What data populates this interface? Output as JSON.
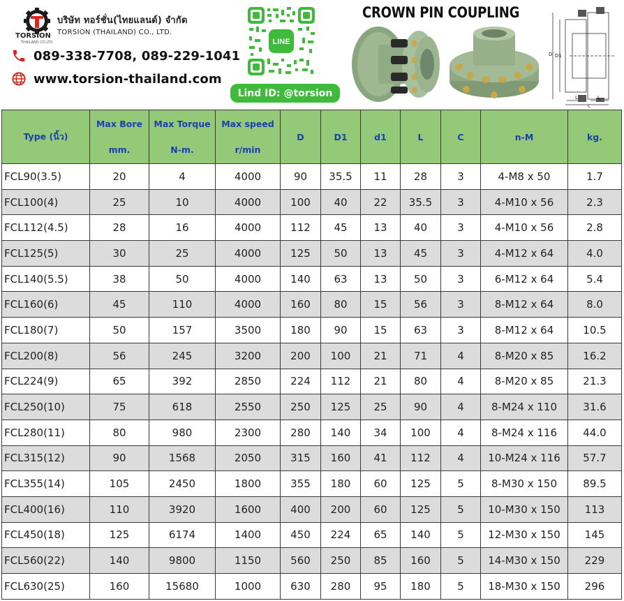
{
  "company": {
    "name_th": "บริษัท ทอร์ชั่น(ไทยแลนด์) จำกัด",
    "name_en": "TORSION (THAILAND) CO., LTD.",
    "logo_text": "TORSION",
    "logo_subtext": "THAILAND CO LTD",
    "phone": "089-338-7708,  089-229-1041",
    "website": "www.torsion-thailand.com",
    "line_id": "Lind ID: @torsion",
    "qr_label": "LINE"
  },
  "product_title": "CROWN PIN COUPLING",
  "drawing_labels": {
    "D": "D",
    "D1": "D1",
    "L": "L",
    "C": "C"
  },
  "colors": {
    "header_bg": "#94c978",
    "header_text": "#1a3fb2",
    "alt_row": "#dcdcdc",
    "line_green": "#3fba3b",
    "brand_red": "#d9261c"
  },
  "table": {
    "headers": [
      {
        "top": "Type (นิ้ว)",
        "bottom": ""
      },
      {
        "top": "Max Bore",
        "bottom": "mm."
      },
      {
        "top": "Max Torque",
        "bottom": "N-m."
      },
      {
        "top": "Max speed",
        "bottom": "r/min"
      },
      {
        "top": "D",
        "bottom": ""
      },
      {
        "top": "D1",
        "bottom": ""
      },
      {
        "top": "d1",
        "bottom": ""
      },
      {
        "top": "L",
        "bottom": ""
      },
      {
        "top": "C",
        "bottom": ""
      },
      {
        "top": "n-M",
        "bottom": ""
      },
      {
        "top": "kg.",
        "bottom": ""
      }
    ],
    "rows": [
      [
        "FCL90(3.5)",
        "20",
        "4",
        "4000",
        "90",
        "35.5",
        "11",
        "28",
        "3",
        "4-M8 x 50",
        "1.7"
      ],
      [
        "FCL100(4)",
        "25",
        "10",
        "4000",
        "100",
        "40",
        "22",
        "35.5",
        "3",
        "4-M10 x 56",
        "2.3"
      ],
      [
        "FCL112(4.5)",
        "28",
        "16",
        "4000",
        "112",
        "45",
        "13",
        "40",
        "3",
        "4-M10 x 56",
        "2.8"
      ],
      [
        "FCL125(5)",
        "30",
        "25",
        "4000",
        "125",
        "50",
        "13",
        "45",
        "3",
        "4-M12 x 64",
        "4.0"
      ],
      [
        "FCL140(5.5)",
        "38",
        "50",
        "4000",
        "140",
        "63",
        "13",
        "50",
        "3",
        "6-M12 x 64",
        "5.4"
      ],
      [
        "FCL160(6)",
        "45",
        "110",
        "4000",
        "160",
        "80",
        "15",
        "56",
        "3",
        "8-M12 x 64",
        "8.0"
      ],
      [
        "FCL180(7)",
        "50",
        "157",
        "3500",
        "180",
        "90",
        "15",
        "63",
        "3",
        "8-M12 x 64",
        "10.5"
      ],
      [
        "FCL200(8)",
        "56",
        "245",
        "3200",
        "200",
        "100",
        "21",
        "71",
        "4",
        "8-M20 x 85",
        "16.2"
      ],
      [
        "FCL224(9)",
        "65",
        "392",
        "2850",
        "224",
        "112",
        "21",
        "80",
        "4",
        "8-M20 x 85",
        "21.3"
      ],
      [
        "FCL250(10)",
        "75",
        "618",
        "2550",
        "250",
        "125",
        "25",
        "90",
        "4",
        "8-M24 x 110",
        "31.6"
      ],
      [
        "FCL280(11)",
        "80",
        "980",
        "2300",
        "280",
        "140",
        "34",
        "100",
        "4",
        "8-M24 x 116",
        "44.0"
      ],
      [
        "FCL315(12)",
        "90",
        "1568",
        "2050",
        "315",
        "160",
        "41",
        "112",
        "4",
        "10-M24 x 116",
        "57.7"
      ],
      [
        "FCL355(14)",
        "105",
        "2450",
        "1800",
        "355",
        "180",
        "60",
        "125",
        "5",
        "8-M30 x 150",
        "89.5"
      ],
      [
        "FCL400(16)",
        "110",
        "3920",
        "1600",
        "400",
        "200",
        "60",
        "125",
        "5",
        "10-M30 x 150",
        "113"
      ],
      [
        "FCL450(18)",
        "125",
        "6174",
        "1400",
        "450",
        "224",
        "65",
        "140",
        "5",
        "12-M30 x 150",
        "145"
      ],
      [
        "FCL560(22)",
        "140",
        "9800",
        "1150",
        "560",
        "250",
        "85",
        "160",
        "5",
        "14-M30 x 150",
        "229"
      ],
      [
        "FCL630(25)",
        "160",
        "15680",
        "1000",
        "630",
        "280",
        "95",
        "180",
        "5",
        "18-M30 x 150",
        "296"
      ]
    ]
  }
}
